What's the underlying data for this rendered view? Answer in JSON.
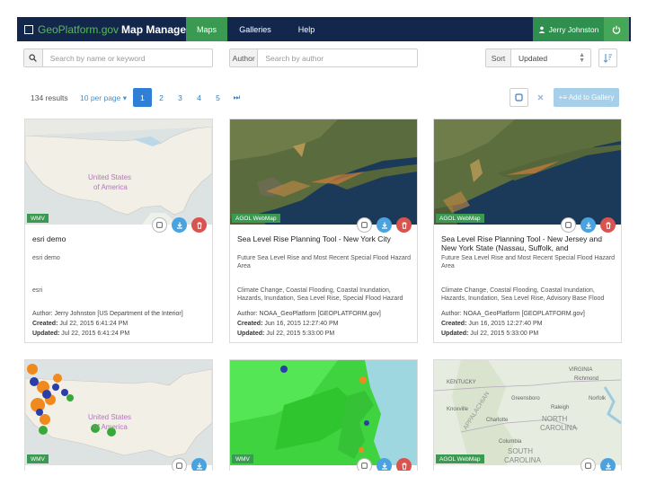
{
  "navbar": {
    "brand_a": "GeoPlatform.gov",
    "brand_b": "Map Manager",
    "tabs": [
      {
        "label": "Maps",
        "active": true
      },
      {
        "label": "Galleries",
        "active": false
      },
      {
        "label": "Help",
        "active": false
      }
    ],
    "user": "Jerry Johnston",
    "user_icon": "person-icon",
    "logout_icon": "power-icon"
  },
  "search": {
    "placeholder": "Search by name or keyword",
    "author_label": "Author",
    "author_placeholder": "Search by author",
    "sort_label": "Sort",
    "sort_value": "Updated"
  },
  "results": {
    "count": "134 results",
    "per_page": "10 per page ▾",
    "pages": [
      "1",
      "2",
      "3",
      "4",
      "5"
    ],
    "current_page": "1",
    "next": "⏭",
    "add_to_gallery": "+≡ Add to Gallery"
  },
  "colors": {
    "navbar": "#13274d",
    "active_tab": "#3a9a52",
    "badge": "#3a9a52",
    "primary": "#2f7fd6",
    "danger": "#d9534f",
    "info": "#4aa3df"
  },
  "cards": [
    {
      "type": "WMV",
      "title": "esri demo",
      "description": "esri demo",
      "tags": "esri",
      "author_label": "Author:",
      "author": "Jerry Johnston [US Department of the Interior]",
      "created_label": "Created:",
      "created": "Jul 22, 2015 6:41:24 PM",
      "updated_label": "Updated:",
      "updated": "Jul 22, 2015 6:41:24 PM",
      "map_label_1": "United States",
      "map_label_2": "of America"
    },
    {
      "type": "AGOL WebMap",
      "title": "Sea Level Rise Planning Tool - New York City",
      "description": "Future Sea Level Rise and Most Recent Special Flood Hazard Area",
      "tags": "Climate Change, Coastal Flooding, Coastal Inundation, Hazards, Inundation, Sea Level Rise, Special Flood Hazard",
      "author_label": "Author:",
      "author": "NOAA_GeoPlatform [GEOPLATFORM.gov]",
      "created_label": "Created:",
      "created": "Jun 16, 2015 12:27:40 PM",
      "updated_label": "Updated:",
      "updated": "Jul 22, 2015 5:33:00 PM"
    },
    {
      "type": "AGOL WebMap",
      "title": "Sea Level Rise Planning Tool - New Jersey and New York State (Nassau, Suffolk, and",
      "description": "Future Sea Level Rise and Most Recent Special Flood Hazard Area",
      "tags": "Climate Change, Coastal Flooding, Coastal Inundation, Hazards, Inundation, Sea Level Rise, Advisory Base Flood",
      "author_label": "Author:",
      "author": "NOAA_GeoPlatform [GEOPLATFORM.gov]",
      "created_label": "Created:",
      "created": "Jun 16, 2015 12:27:40 PM",
      "updated_label": "Updated:",
      "updated": "Jul 22, 2015 5:33:00 PM"
    },
    {
      "type": "WMV",
      "map_label_1": "United States",
      "map_label_2": "of America"
    },
    {
      "type": "WMV"
    },
    {
      "type": "AGOL WebMap",
      "map_labels": [
        "KENTUCKY",
        "VIRGINIA",
        "Richmond",
        "Norfolk",
        "Greensboro",
        "Raleigh",
        "NORTH",
        "CAROLINA",
        "Charlotte",
        "Columbia",
        "SOUTH",
        "CAROLINA",
        "Knoxville",
        "APPALACHIAN"
      ]
    }
  ]
}
